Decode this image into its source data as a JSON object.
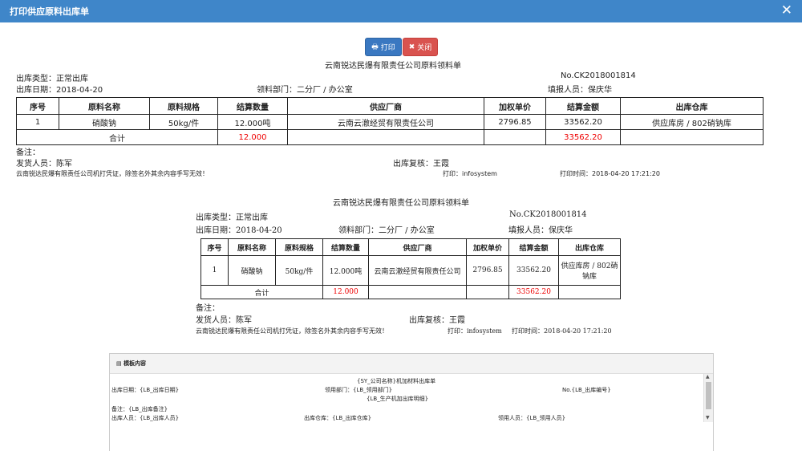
{
  "window": {
    "title": "打印供应原料出库单"
  },
  "toolbar": {
    "print_label": "打印",
    "close_label": "关闭"
  },
  "doc": {
    "title": "云南锐达民爆有限责任公司原料领料单",
    "type_label": "出库类型：",
    "type_value": "正常出库",
    "no_label": "No.",
    "no_value": "CK2018001814",
    "date_label": "出库日期：",
    "date_value": "2018-04-20",
    "dept_label": "领料部门：",
    "dept_value": "二分厂 / 办公室",
    "reporter_label": "填报人员：",
    "reporter_value": "保庆华",
    "columns": [
      "序号",
      "原料名称",
      "原料规格",
      "结算数量",
      "供应厂商",
      "加权单价",
      "结算金额",
      "出库仓库"
    ],
    "row": {
      "seq": "1",
      "name": "硝酸钠",
      "spec": "50kg/件",
      "qty": "12.000吨",
      "supplier": "云南云澈经贸有限责任公司",
      "price": "2796.85",
      "amount": "33562.20",
      "warehouse": "供应库房 / 802硝钠库"
    },
    "total_label": "合计",
    "total_qty": "12.000",
    "total_amount": "33562.20",
    "remark_label": "备注：",
    "sender_label": "发货人员：",
    "sender_value": "陈军",
    "reviewer_label": "出库复核：",
    "reviewer_value": "王霞",
    "note": "云南锐达民爆有限责任公司机打凭证，除签名外其余内容手写无效！",
    "printer_label": "打印：",
    "printer_value": "infosystem",
    "print_time_label": "打印时间：",
    "print_time_value": "2018-04-20 17:21:20"
  },
  "panel": {
    "title": "模板内容",
    "line1": "{SY_公司名称}机加材料出库单",
    "date_field": "出库日期：{LB_出库日期}",
    "dept_field": "领用部门：{LB_领用部门}",
    "no_field": "No.{LB_出库编号}",
    "detail_field": "{LB_生产机加出库明细}",
    "remark_field": "备注：{LB_出库备注}",
    "sender_field": "出库人员：{LB_出库人员}",
    "warehouse_field": "出库仓库：{LB_出库仓库}",
    "user_field": "领用人员：{LB_领用人员}"
  },
  "colors": {
    "titlebar": "#3f86c9",
    "print_button": "#3a78c1",
    "close_button": "#d9534f",
    "total_red": "#e00000"
  }
}
